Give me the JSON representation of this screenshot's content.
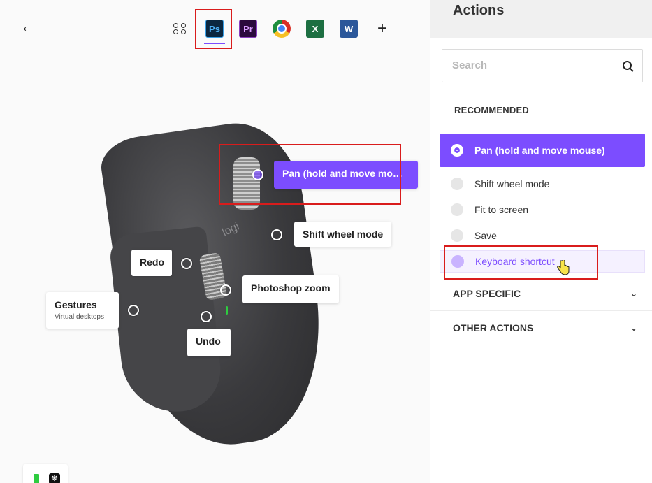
{
  "nav": {
    "back_icon": "←"
  },
  "apps": [
    {
      "name": "all-apps",
      "label": ""
    },
    {
      "name": "photoshop",
      "label": "Ps"
    },
    {
      "name": "premiere",
      "label": "Pr"
    },
    {
      "name": "chrome",
      "label": ""
    },
    {
      "name": "excel",
      "label": "X"
    },
    {
      "name": "word",
      "label": "W"
    },
    {
      "name": "add",
      "label": "+"
    }
  ],
  "mouse": {
    "logo": "logi",
    "callouts": {
      "pan": "Pan (hold and move mo…",
      "shift_wheel": "Shift wheel mode",
      "redo": "Redo",
      "photoshop_zoom": "Photoshop zoom",
      "gestures": "Gestures",
      "gestures_sub": "Virtual desktops",
      "undo": "Undo"
    }
  },
  "panel": {
    "title": "Actions",
    "search_placeholder": "Search",
    "recommended_title": "RECOMMENDED",
    "recommended_items": [
      "Pan (hold and move mouse)",
      "Shift wheel mode",
      "Fit to screen",
      "Save",
      "Keyboard shortcut"
    ],
    "app_specific": "APP SPECIFIC",
    "other_actions": "OTHER ACTIONS"
  },
  "colors": {
    "accent": "#7c4dff",
    "highlight": "#d91c1c"
  }
}
